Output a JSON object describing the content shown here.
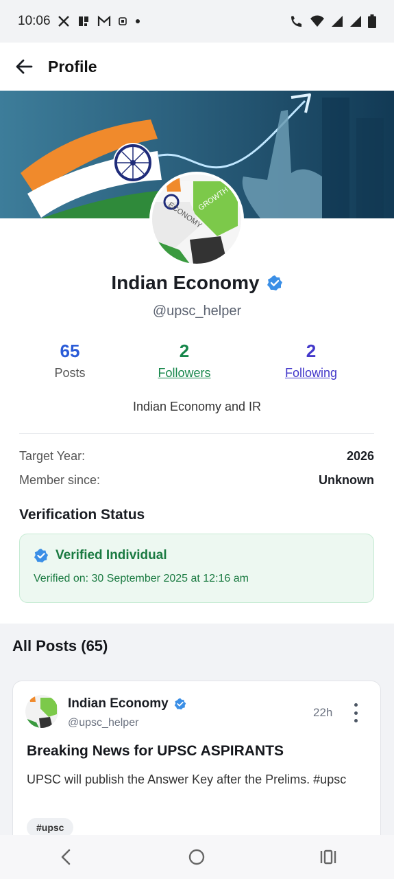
{
  "status_bar": {
    "time": "10:06"
  },
  "app_bar": {
    "title": "Profile"
  },
  "profile": {
    "name": "Indian Economy",
    "handle": "@upsc_helper",
    "bio": "Indian Economy and IR",
    "avatar_text_1": "GROWTH",
    "avatar_text_2": "ECONOMY"
  },
  "stats": {
    "posts": {
      "value": "65",
      "label": "Posts",
      "color": "#2a5bd7"
    },
    "followers": {
      "value": "2",
      "label": "Followers",
      "color": "#16864a"
    },
    "following": {
      "value": "2",
      "label": "Following",
      "color": "#4338ca"
    }
  },
  "details": {
    "target_year_label": "Target Year:",
    "target_year_value": "2026",
    "member_since_label": "Member since:",
    "member_since_value": "Unknown"
  },
  "verification": {
    "section_title": "Verification Status",
    "status": "Verified Individual",
    "date": "Verified on: 30 September 2025 at 12:16 am"
  },
  "posts": {
    "title": "All Posts (65)",
    "items": [
      {
        "author": "Indian Economy",
        "handle": "@upsc_helper",
        "time": "22h",
        "title": "Breaking News for UPSC ASPIRANTS",
        "body": "UPSC will publish the Answer Key after the Prelims. #upsc",
        "tag": "#upsc"
      }
    ]
  },
  "colors": {
    "verified_blue": "#3b8fe6",
    "verified_green": "#1a7a41",
    "banner_bg": "#2a5d7a"
  },
  "icons": {
    "back": "arrow-left-icon",
    "verified": "verified-badge-icon",
    "more": "more-vertical-icon"
  }
}
